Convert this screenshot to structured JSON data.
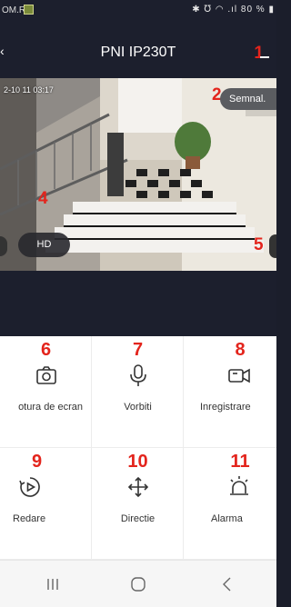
{
  "status_bar": {
    "carrier": "OM.RO",
    "battery": "80 %"
  },
  "header": {
    "title": "PNI IP230T"
  },
  "video": {
    "timestamp": "2-10 11 03:17",
    "signal_button": "Semnal.",
    "hd_button": "HD"
  },
  "markers": {
    "m1": "1",
    "m2": "2",
    "m4": "4",
    "m5": "5"
  },
  "actions": [
    {
      "num": "6",
      "label": "otura de ecran",
      "icon": "camera-icon"
    },
    {
      "num": "7",
      "label": "Vorbiti",
      "icon": "microphone-icon"
    },
    {
      "num": "8",
      "label": "Inregistrare",
      "icon": "video-camera-icon"
    },
    {
      "num": "9",
      "label": "Redare",
      "icon": "playback-icon"
    },
    {
      "num": "10",
      "label": "Directie",
      "icon": "move-arrows-icon"
    },
    {
      "num": "11",
      "label": "Alarma",
      "icon": "alarm-siren-icon"
    }
  ],
  "colors": {
    "marker_red": "#e3241c",
    "dark_bg": "#1c1f2d"
  }
}
